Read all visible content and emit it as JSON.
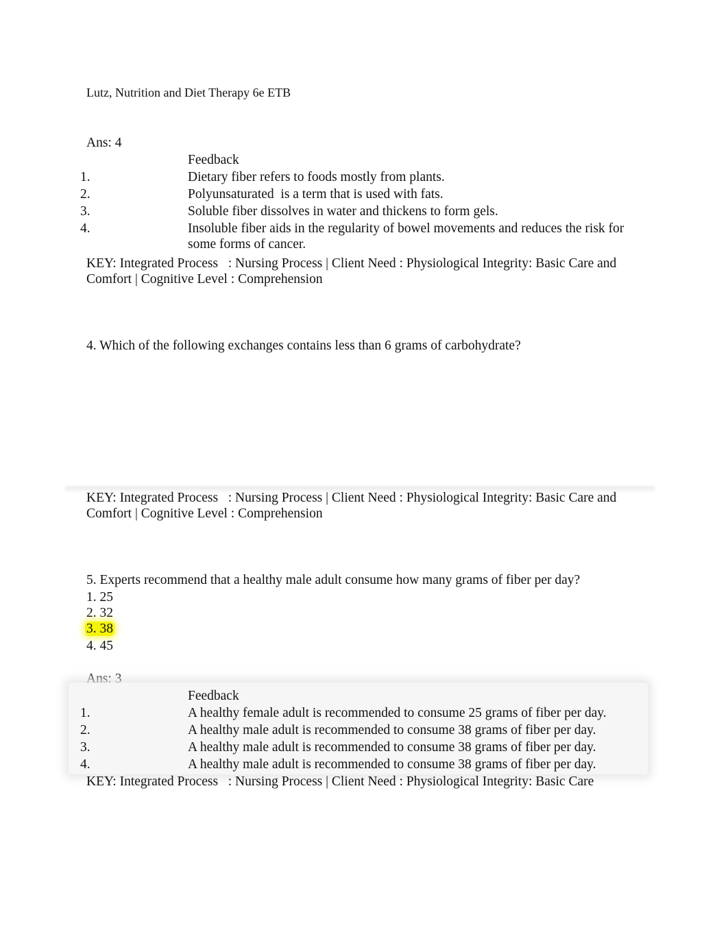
{
  "document": {
    "header": "Lutz, Nutrition and Diet Therapy 6e ETB"
  },
  "question3_answer": {
    "answer": "Ans: 4",
    "feedback_heading": "Feedback",
    "feedback": [
      {
        "num": "1.",
        "text": "Dietary fiber refers to foods mostly from plants."
      },
      {
        "num": "2.",
        "text": "Polyunsaturated  is a term that is used with fats."
      },
      {
        "num": "3.",
        "text": "Soluble fiber dissolves in water and thickens to form gels."
      },
      {
        "num": "4.",
        "text": "Insoluble fiber aids in the regularity of bowel movements and reduces the risk for some forms of cancer."
      }
    ],
    "key": "KEY: Integrated Process   : Nursing Process | Client Need : Physiological Integrity: Basic Care and Comfort | Cognitive Level : Comprehension"
  },
  "question4": {
    "question": "4. Which of the following exchanges contains less than 6 grams of carbohydrate?",
    "key": "KEY: Integrated Process   : Nursing Process | Client Need : Physiological Integrity: Basic Care and Comfort | Cognitive Level : Comprehension"
  },
  "question5": {
    "question": "5. Experts recommend that a healthy male adult consume how many grams of fiber per day?",
    "options": [
      "1. 25",
      "2. 32",
      "3. 38",
      "4. 45"
    ],
    "highlighted_option_index": 2,
    "highlight_color": "#f4f40a",
    "answer": "Ans: 3",
    "feedback_heading": "Feedback",
    "feedback": [
      {
        "num": "1.",
        "text": "A healthy female adult is recommended to consume 25 grams of fiber per day."
      },
      {
        "num": "2.",
        "text": "A healthy male adult is recommended to consume 38 grams of fiber per day."
      },
      {
        "num": "3.",
        "text": "A healthy male adult is recommended to consume 38 grams of fiber per day."
      },
      {
        "num": "4.",
        "text": "A healthy male adult is recommended to consume 38 grams of fiber per day."
      }
    ],
    "key": "KEY: Integrated Process   : Nursing Process | Client Need : Physiological Integrity: Basic Care"
  }
}
